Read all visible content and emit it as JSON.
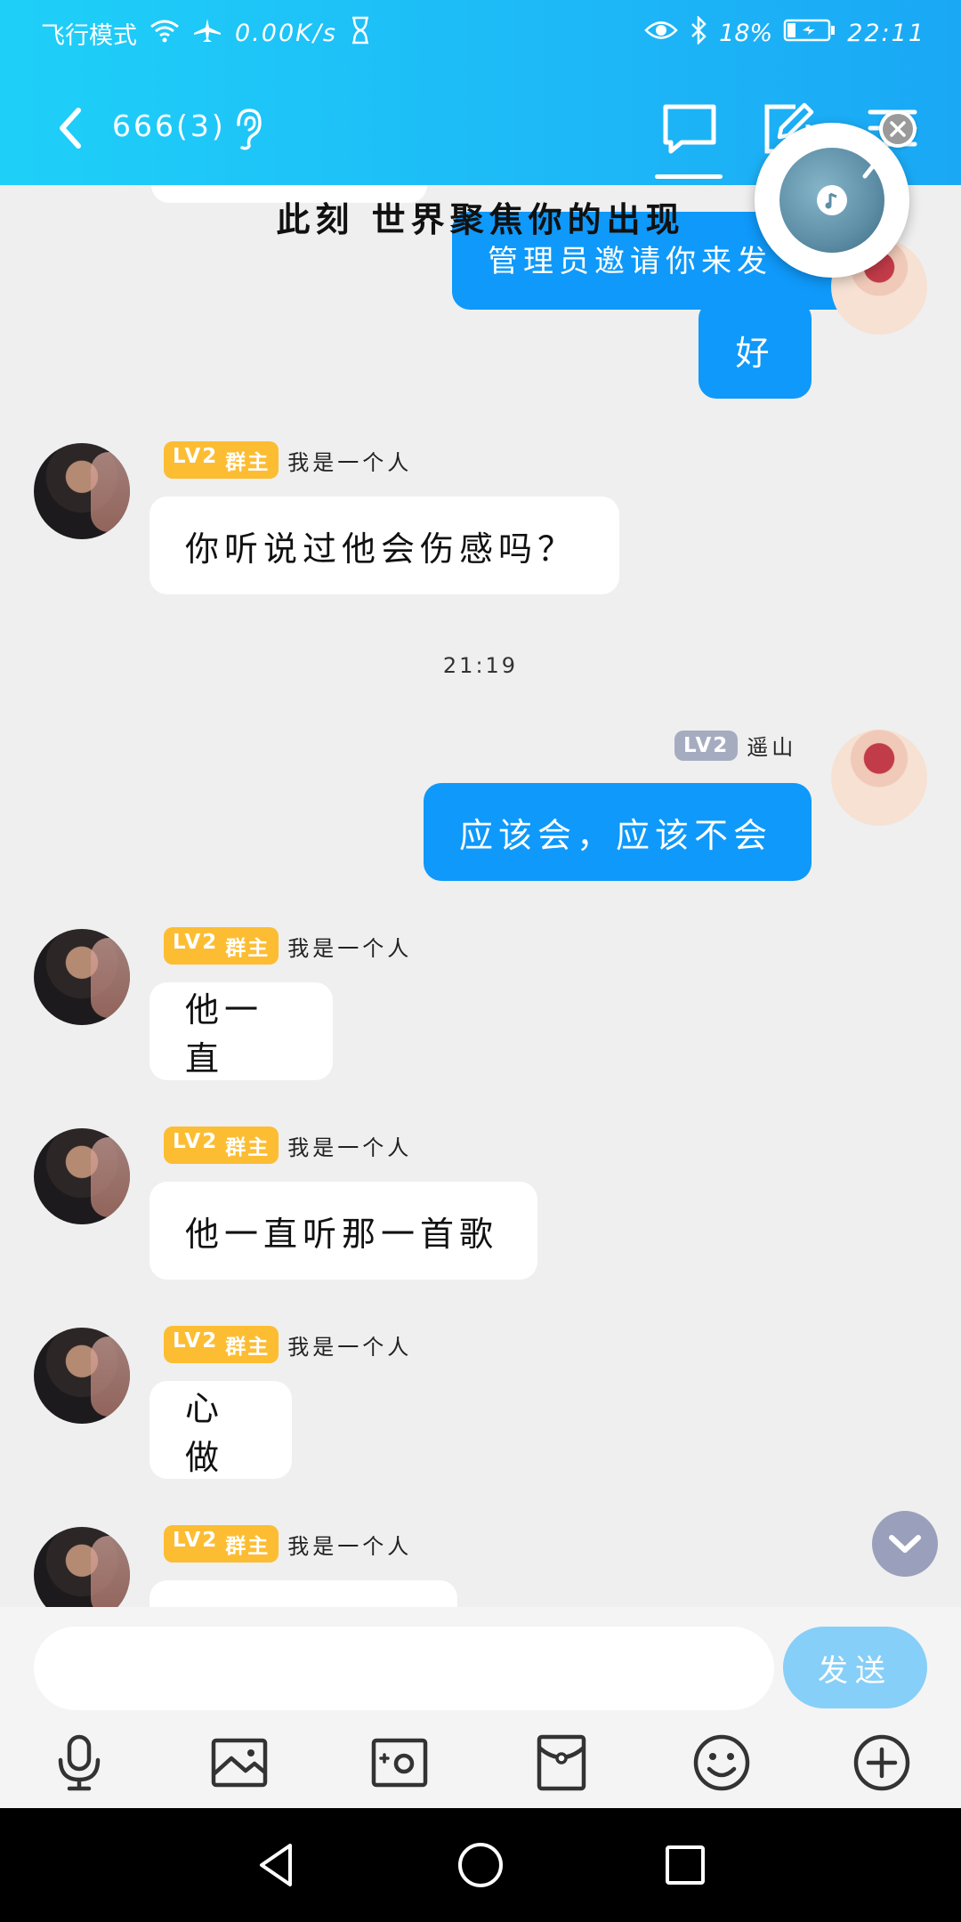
{
  "status_bar": {
    "airplane_label": "飞行模式",
    "speed": "0.00K/s",
    "battery": "18%",
    "time": "22:11",
    "icons": [
      "wifi-icon",
      "airplane-icon",
      "hourglass-icon",
      "eye-icon",
      "bluetooth-icon",
      "battery-icon"
    ]
  },
  "header": {
    "title": "666(3)",
    "icons": [
      "back-icon",
      "ear-icon",
      "chat-icon",
      "edit-icon",
      "menu-icon"
    ]
  },
  "music_widget": {
    "icons": [
      "music-note-icon",
      "close-icon"
    ]
  },
  "overlay_text": "此刻 世界聚焦你的出现",
  "messages": [
    {
      "side": "right",
      "text": "管理员邀请你来发",
      "partial": true
    },
    {
      "side": "right",
      "text": "好"
    },
    {
      "side": "left",
      "level": "LV2",
      "role": "群主",
      "name": "我是一个人",
      "text": "你听说过他会伤感吗？"
    },
    {
      "timestamp": "21:19"
    },
    {
      "side": "right",
      "level": "LV2",
      "name": "遥山",
      "text": "应该会，应该不会"
    },
    {
      "side": "left",
      "level": "LV2",
      "role": "群主",
      "name": "我是一个人",
      "text": "他一直"
    },
    {
      "side": "left",
      "level": "LV2",
      "role": "群主",
      "name": "我是一个人",
      "text": "他一直听那一首歌"
    },
    {
      "side": "left",
      "level": "LV2",
      "role": "群主",
      "name": "我是一个人",
      "text": "心做"
    },
    {
      "side": "left",
      "level": "LV2",
      "role": "群主",
      "name": "我是一个人",
      "text": ""
    }
  ],
  "input_bar": {
    "placeholder": "",
    "send_label": "发送",
    "tools": [
      "microphone-icon",
      "image-icon",
      "camera-icon",
      "red-packet-icon",
      "emoji-icon",
      "plus-icon"
    ]
  },
  "nav": {
    "icons": [
      "nav-back-icon",
      "nav-home-icon",
      "nav-recents-icon"
    ]
  },
  "colors": {
    "header": "#1db8f7",
    "bubble_blue": "#0f99fa",
    "badge_gold": "#fcbd33",
    "badge_grey": "#a6acc0",
    "send_button": "#86cff8"
  }
}
